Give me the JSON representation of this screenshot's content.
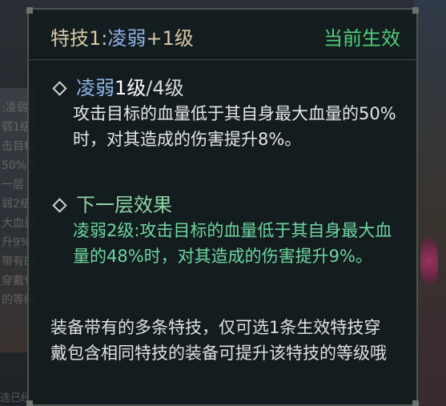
{
  "background": {
    "left_text_lines": [
      ":凌弱",
      "弱1级",
      "击目标",
      "50%时",
      "一层",
      "弱2级",
      "大血量",
      "升9%",
      "带有的",
      "穿戴包",
      "的等级"
    ],
    "bottom_text": "选已经"
  },
  "tooltip": {
    "header": {
      "prefix": "特技1:",
      "name": "凌弱",
      "suffix": "+1级",
      "status": "当前生效"
    },
    "current": {
      "name": "凌弱",
      "level": "1级",
      "max_level": "/4级",
      "description": "攻击目标的血量低于其自身最大血量的50%时，对其造成的伤害提升8%。"
    },
    "next": {
      "title": "下一层效果",
      "description": "凌弱2级:攻击目标的血量低于其自身最大血量的48%时，对其造成的伤害提升9%。"
    },
    "note": "装备带有的多条特技，仅可选1条生效特技穿戴包含相同特技的装备可提升该特技的等级哦"
  },
  "colors": {
    "title": "#d7c9a8",
    "skill_name": "#8fb3e6",
    "status": "#4fd07a",
    "next_effect": "#6fd6a0",
    "body_text": "#e6e6e6"
  },
  "icons": [
    "diamond-icon"
  ]
}
